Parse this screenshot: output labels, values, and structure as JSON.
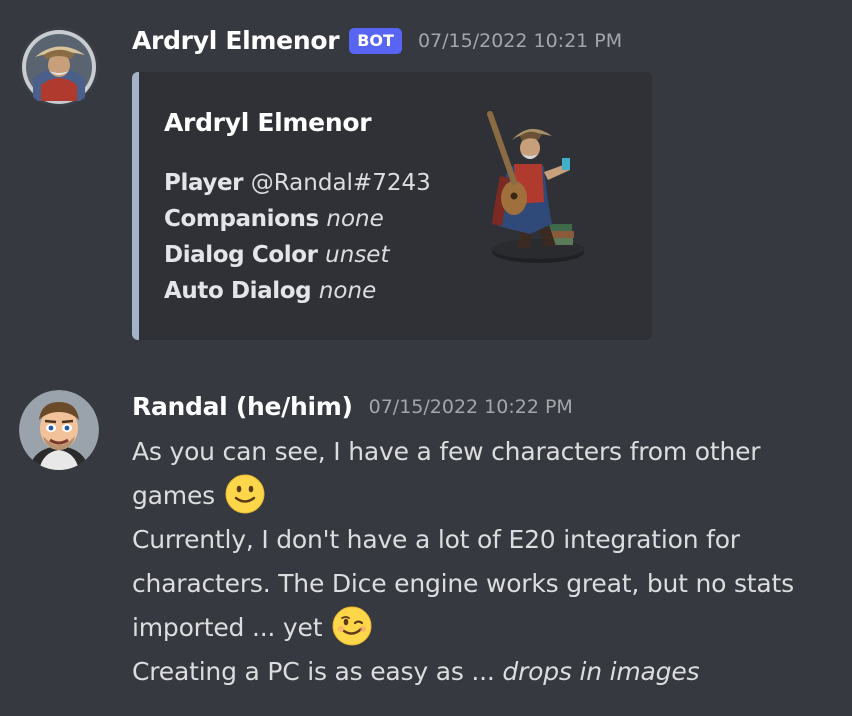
{
  "message1": {
    "author": "Ardryl Elmenor",
    "badge": "BOT",
    "timestamp": "07/15/2022 10:21 PM",
    "avatar_icon": "character-portrait-icon",
    "embed": {
      "accent_color": "#a5b3c8",
      "title": "Ardryl Elmenor",
      "thumbnail_icon": "bard-figurine-icon",
      "fields": [
        {
          "name": "Player",
          "value": "@Randal#7243",
          "italic": false
        },
        {
          "name": "Companions",
          "value": "none",
          "italic": true
        },
        {
          "name": "Dialog Color",
          "value": "unset",
          "italic": true
        },
        {
          "name": "Auto Dialog",
          "value": "none",
          "italic": true
        }
      ]
    }
  },
  "message2": {
    "author": "Randal (he/him)",
    "timestamp": "07/15/2022 10:22 PM",
    "avatar_icon": "cartoon-portrait-icon",
    "lines": [
      {
        "text": "As you can see, I have a few characters from other"
      },
      {
        "text": "games",
        "emoji": "slightly-smiling-face-icon"
      },
      {
        "text": "Currently, I don't have a lot of E20 integration for"
      },
      {
        "text": "characters. The Dice engine works great, but no stats"
      },
      {
        "text": "imported ... yet",
        "emoji": "winking-face-icon"
      },
      {
        "text": "Creating a PC is as easy as ... ",
        "italic_suffix": "drops in images"
      }
    ]
  },
  "colors": {
    "background": "#36393f",
    "embed_background": "#2f3136",
    "bot_badge": "#5865f2",
    "username": "#ffffff",
    "text": "#dcddde",
    "timestamp": "#a3a6aa"
  }
}
